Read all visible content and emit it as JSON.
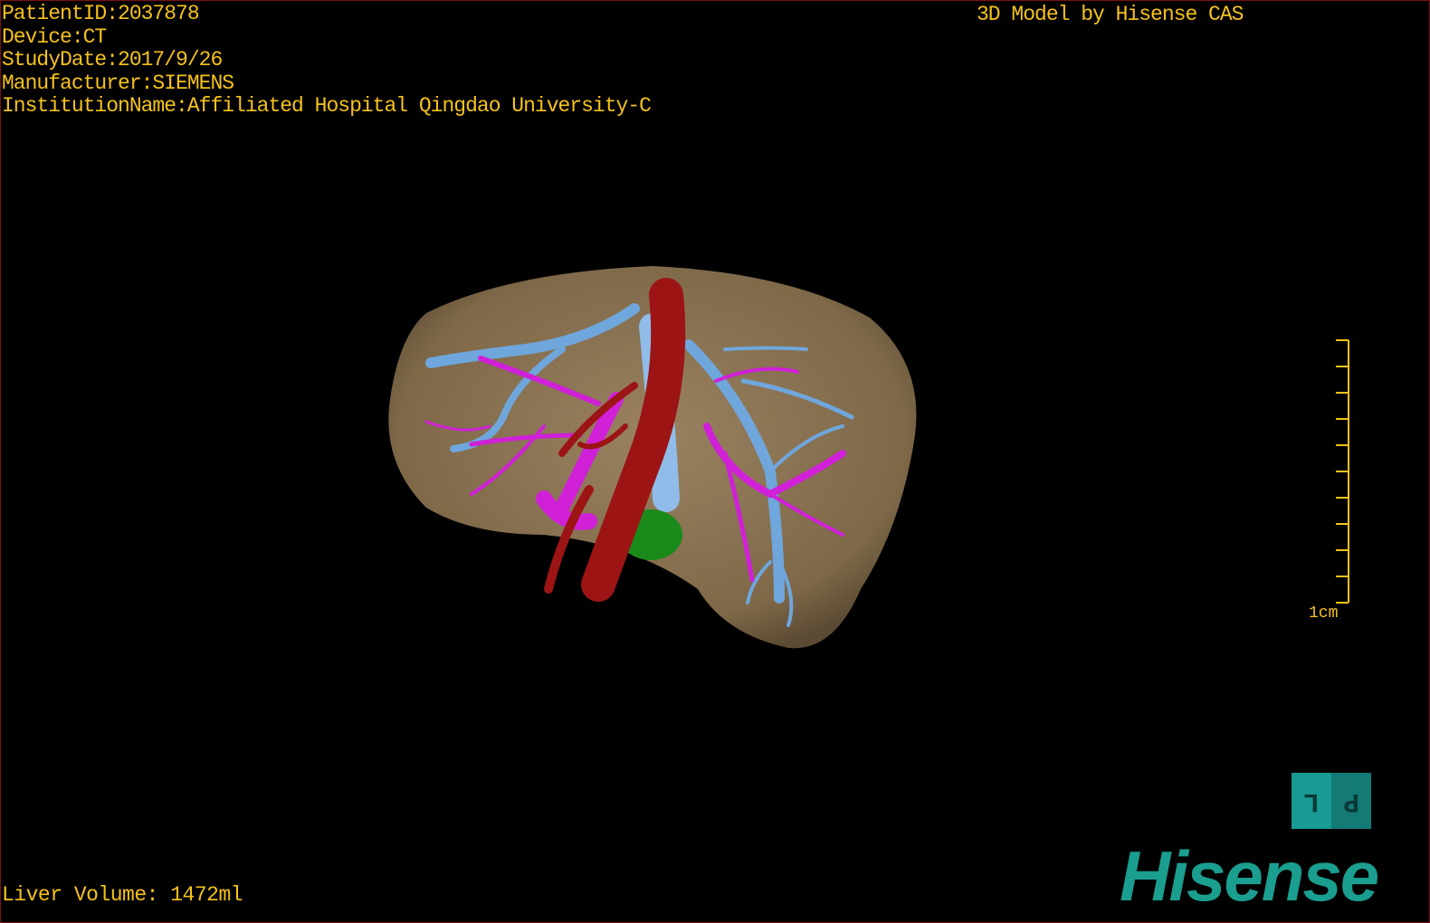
{
  "overlay": {
    "patient_id": "PatientID:2037878",
    "device": "Device:CT",
    "study_date": "StudyDate:2017/9/26",
    "manufacturer": "Manufacturer:SIEMENS",
    "institution": "InstitutionName:Affiliated Hospital Qingdao University-C",
    "title": "3D Model by Hisense CAS",
    "liver_volume": "Liver Volume: 1472ml",
    "scale_label": "1cm"
  },
  "view_toggle": {
    "left": "L",
    "right": "P"
  },
  "brand": {
    "logo": "Hisense"
  },
  "colors": {
    "text": "#f5c21b",
    "liver": "#8a7352",
    "hepatic_vein": "#6fa6dc",
    "portal_vein": "#d020d8",
    "artery_ivc": "#9c1414",
    "gallbladder": "#1a8a1a",
    "brand": "#1a9e8f"
  }
}
